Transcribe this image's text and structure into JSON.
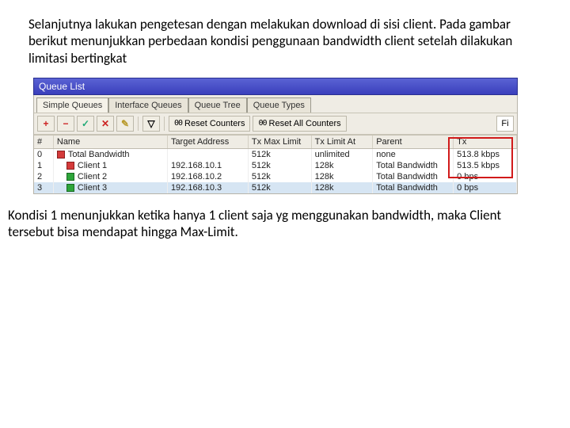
{
  "para1": "Selanjutnya lakukan pengetesan dengan melakukan download di sisi client. Pada gambar berikut menunjukkan perbedaan kondisi penggunaan bandwidth client setelah dilakukan limitasi bertingkat",
  "para2": "Kondisi 1 menunjukkan ketika hanya 1 client saja yg menggunakan bandwidth, maka Client tersebut bisa mendapat hingga Max-Limit.",
  "window": {
    "title": "Queue List",
    "tabs": [
      "Simple Queues",
      "Interface Queues",
      "Queue Tree",
      "Queue Types"
    ],
    "toolbar": {
      "add": "+",
      "remove": "−",
      "enable": "✓",
      "disable": "✕",
      "comment": "✎",
      "filter": "▽",
      "reset": "Reset Counters",
      "reset_all": "Reset All Counters",
      "oo": "00",
      "find": "Fi"
    },
    "headers": {
      "num": "#",
      "name": "Name",
      "target": "Target Address",
      "txmax": "Tx Max Limit",
      "txlim": "Tx Limit At",
      "parent": "Parent",
      "tx": "Tx"
    },
    "rows": [
      {
        "num": "0",
        "icon": "red",
        "indent": false,
        "name": "Total Bandwidth",
        "target": "",
        "txmax": "512k",
        "txlim": "unlimited",
        "parent": "none",
        "tx": "513.8 kbps"
      },
      {
        "num": "1",
        "icon": "red",
        "indent": true,
        "name": "Client 1",
        "target": "192.168.10.1",
        "txmax": "512k",
        "txlim": "128k",
        "parent": "Total Bandwidth",
        "tx": "513.5 kbps"
      },
      {
        "num": "2",
        "icon": "green",
        "indent": true,
        "name": "Client 2",
        "target": "192.168.10.2",
        "txmax": "512k",
        "txlim": "128k",
        "parent": "Total Bandwidth",
        "tx": "0 bps"
      },
      {
        "num": "3",
        "icon": "green",
        "indent": true,
        "name": "Client 3",
        "target": "192.168.10.3",
        "txmax": "512k",
        "txlim": "128k",
        "parent": "Total Bandwidth",
        "tx": "0 bps",
        "sel": true
      }
    ]
  }
}
